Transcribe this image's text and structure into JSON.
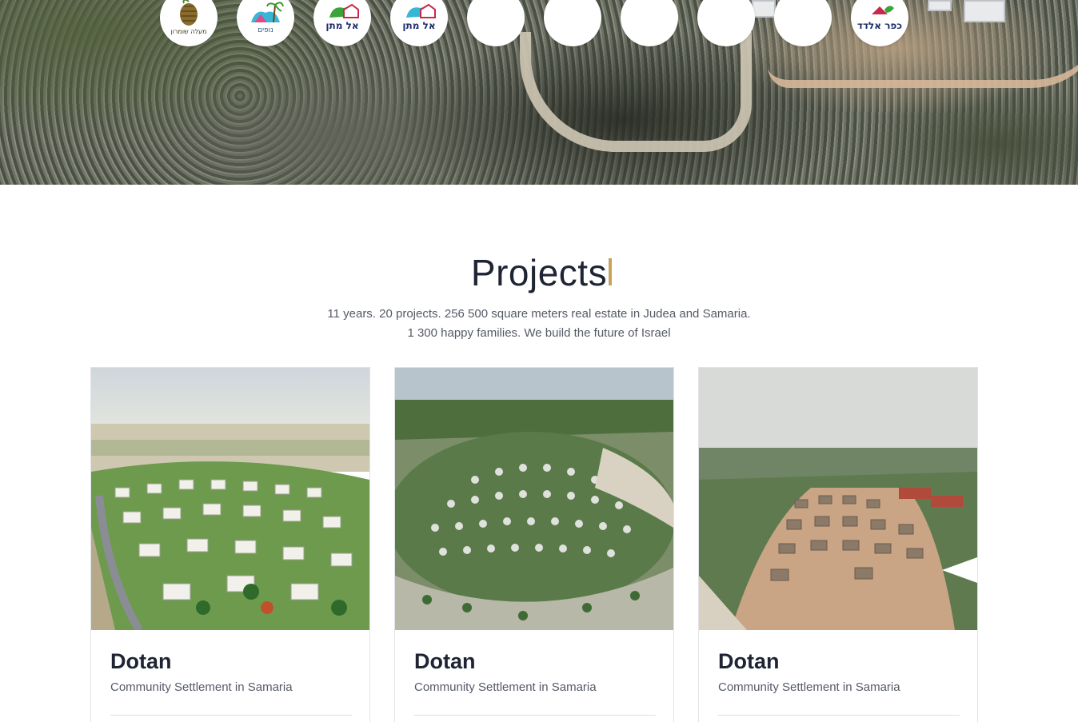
{
  "logos": [
    {
      "name": "maale-shomron-logo",
      "text": "מעלה שומרון",
      "kind": "pinecone"
    },
    {
      "name": "nofim-logo",
      "text": "נופים",
      "kind": "palm"
    },
    {
      "name": "el-matan-logo-1",
      "text": "אל מתן",
      "kind": "house"
    },
    {
      "name": "el-matan-logo-2",
      "text": "אל מתן",
      "kind": "house"
    },
    {
      "name": "empty-logo-1",
      "text": "",
      "kind": "empty"
    },
    {
      "name": "empty-logo-2",
      "text": "",
      "kind": "empty"
    },
    {
      "name": "empty-logo-3",
      "text": "",
      "kind": "empty"
    },
    {
      "name": "empty-logo-4",
      "text": "",
      "kind": "empty"
    },
    {
      "name": "empty-logo-5",
      "text": "",
      "kind": "empty"
    },
    {
      "name": "kfar-eldad-logo",
      "text": "כפר אלדד",
      "kind": "eldad"
    }
  ],
  "projects": {
    "title": "Projects",
    "subtitle_line1": "11 years. 20 projects. 256 500 square meters real estate in Judea and Samaria.",
    "subtitle_line2": "1 300 happy families. We build the future of Israel",
    "cards": [
      {
        "name": "Dotan",
        "description": "Community Settlement in Samaria"
      },
      {
        "name": "Dotan",
        "description": "Community Settlement in Samaria"
      },
      {
        "name": "Dotan",
        "description": "Community Settlement in Samaria"
      }
    ]
  },
  "colors": {
    "accent": "#c9a25d",
    "heading": "#1f2434",
    "body_text": "#555a66"
  },
  "icons": {
    "slider_next": "next-arrow-icon"
  }
}
